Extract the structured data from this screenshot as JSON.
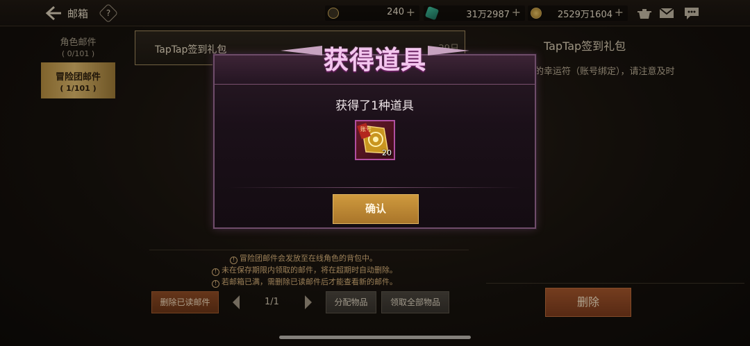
{
  "topbar": {
    "title": "邮箱",
    "help_label": "?",
    "currencies": [
      {
        "icon": "gold-coin-icon",
        "value": "240"
      },
      {
        "icon": "green-gem-icon",
        "value": "31万2987"
      },
      {
        "icon": "gold-medal-icon",
        "value": "2529万1604"
      }
    ],
    "plus_label": "+"
  },
  "sidebar": {
    "items": [
      {
        "label": "角色邮件",
        "count": "( 0/101 )"
      },
      {
        "label": "冒险团邮件",
        "count": "( 1/101 )"
      }
    ]
  },
  "mail_list": {
    "items": [
      {
        "title": "TapTap签到礼包",
        "days": "29日"
      }
    ]
  },
  "detail": {
    "title": "TapTap签到礼包",
    "body": "的幸运符（账号绑定），请注意及时",
    "delete_label": "删除"
  },
  "notices": [
    "冒险团邮件会发放至在线角色的背包中。",
    "未在保存期限内领取的邮件，将在超期时自动删除。",
    "若邮箱已满，需删除已读邮件后才能查看新的邮件。"
  ],
  "bottom": {
    "delete_read_label": "删除已读邮件",
    "page": "1/1",
    "distribute_label": "分配物品",
    "claim_all_label": "领取全部物品"
  },
  "dialog": {
    "title": "获得道具",
    "message": "获得了1种道具",
    "item": {
      "icon": "lucky-charm-scroll-icon",
      "tag": "账号",
      "quantity": "20"
    },
    "confirm_label": "确认"
  },
  "colors": {
    "accent_gold": "#d8b469",
    "dialog_title": "#f4c6ef",
    "delete_button": "#a2552b",
    "confirm_button": "#cf9a3e"
  }
}
